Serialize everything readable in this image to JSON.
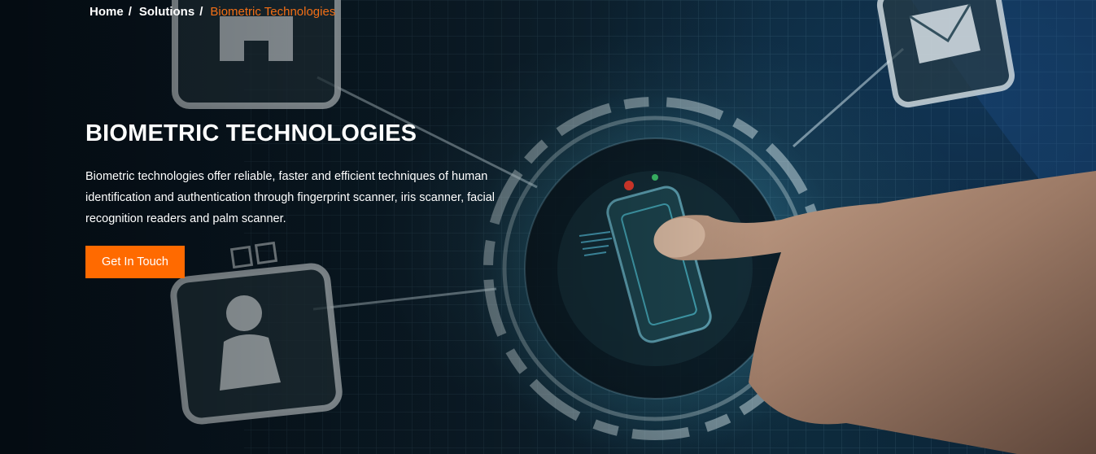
{
  "breadcrumb": {
    "items": [
      {
        "label": "Home"
      },
      {
        "label": "Solutions"
      }
    ],
    "separator": "/",
    "current": "Biometric Technologies"
  },
  "hero": {
    "title": "BIOMETRIC TECHNOLOGIES",
    "description": "Biometric technologies offer reliable, faster and efficient techniques of human identification and authentication through fingerprint scanner, iris scanner, facial recognition readers and palm scanner.",
    "cta_label": "Get In Touch"
  },
  "colors": {
    "accent": "#ff6a00",
    "breadcrumb_current": "#f36f16",
    "text": "#ffffff"
  },
  "icons": [
    "home-icon",
    "mail-icon",
    "user-icon",
    "fingerprint-scanner-icon"
  ]
}
